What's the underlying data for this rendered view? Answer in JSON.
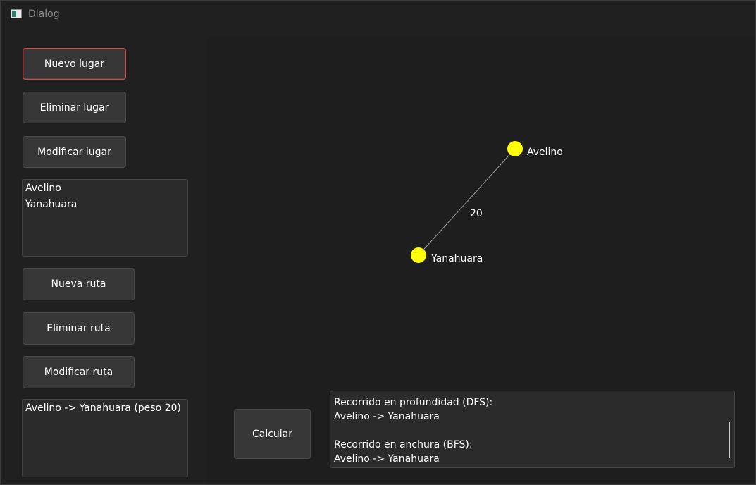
{
  "window": {
    "title": "Dialog"
  },
  "places": {
    "new_label": "Nuevo lugar",
    "delete_label": "Eliminar lugar",
    "modify_label": "Modificar lugar",
    "items": [
      "Avelino",
      "Yanahuara"
    ]
  },
  "routes": {
    "new_label": "Nueva ruta",
    "delete_label": "Eliminar ruta",
    "modify_label": "Modificar ruta",
    "items": [
      "Avelino -> Yanahuara (peso 20)"
    ]
  },
  "graph": {
    "node_color": "#ffff00",
    "edge_color": "#a0a0a0",
    "nodes": [
      {
        "name": "Avelino"
      },
      {
        "name": "Yanahuara"
      }
    ],
    "edges": [
      {
        "from": "Avelino",
        "to": "Yanahuara",
        "weight": "20"
      }
    ]
  },
  "calculate": {
    "label": "Calcular"
  },
  "output": {
    "lines": [
      "Recorrido en profundidad (DFS):",
      "Avelino -> Yanahuara",
      "",
      "Recorrido en anchura (BFS):",
      "Avelino -> Yanahuara"
    ]
  }
}
